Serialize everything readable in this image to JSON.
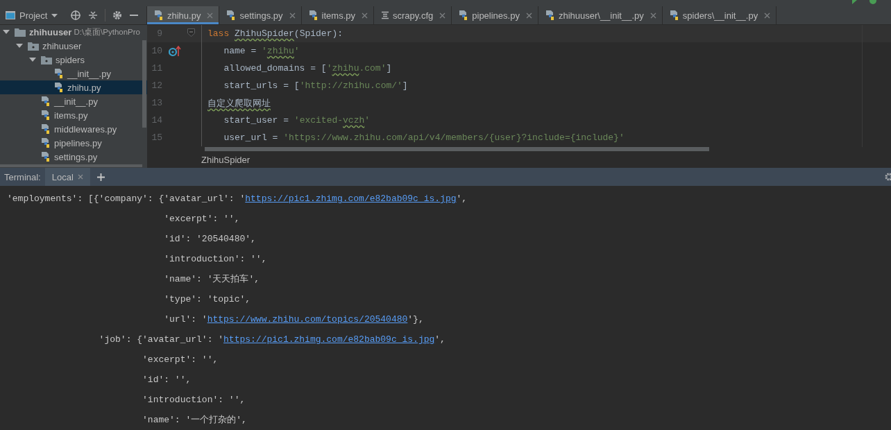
{
  "toolbar": {
    "view_label": "Project"
  },
  "editor_tabs": [
    {
      "label": "zhihu.py",
      "kind": "python",
      "selected": true
    },
    {
      "label": "settings.py",
      "kind": "python",
      "selected": false
    },
    {
      "label": "items.py",
      "kind": "python",
      "selected": false
    },
    {
      "label": "scrapy.cfg",
      "kind": "config",
      "selected": false
    },
    {
      "label": "pipelines.py",
      "kind": "python",
      "selected": false
    },
    {
      "label": "zhihuuser\\__init__.py",
      "kind": "python",
      "selected": false
    },
    {
      "label": "spiders\\__init__.py",
      "kind": "python",
      "selected": false
    }
  ],
  "project_tree": [
    {
      "label": "zhihuuser",
      "path": "D:\\桌面\\PythonPro",
      "kind": "root",
      "expanded": true,
      "selected": false,
      "children": [
        {
          "label": "zhihuuser",
          "kind": "package",
          "expanded": true,
          "selected": false,
          "children": [
            {
              "label": "spiders",
              "kind": "package",
              "expanded": true,
              "selected": false,
              "children": [
                {
                  "label": "__init__.py",
                  "kind": "python",
                  "selected": false
                },
                {
                  "label": "zhihu.py",
                  "kind": "python",
                  "selected": true
                }
              ]
            },
            {
              "label": "__init__.py",
              "kind": "python",
              "selected": false
            },
            {
              "label": "items.py",
              "kind": "python",
              "selected": false
            },
            {
              "label": "middlewares.py",
              "kind": "python",
              "selected": false
            },
            {
              "label": "pipelines.py",
              "kind": "python",
              "selected": false
            },
            {
              "label": "settings.py",
              "kind": "python",
              "selected": false
            }
          ]
        }
      ]
    }
  ],
  "code_lines": [
    {
      "number": "9",
      "kind": "fold",
      "segments": [
        {
          "text": "lass ",
          "kind": "keyword"
        },
        {
          "text": "ZhihuSpider",
          "kind": "plain-typo"
        },
        {
          "text": "(Spider):",
          "kind": "plain"
        }
      ]
    },
    {
      "number": "10",
      "kind": "override",
      "segments": [
        {
          "text": "   name = ",
          "kind": "plain"
        },
        {
          "text": "'",
          "kind": "string"
        },
        {
          "text": "zhihu",
          "kind": "string-typo"
        },
        {
          "text": "'",
          "kind": "string"
        }
      ]
    },
    {
      "number": "11",
      "segments": [
        {
          "text": "   allowed_domains = [",
          "kind": "plain"
        },
        {
          "text": "'",
          "kind": "string"
        },
        {
          "text": "zhihu",
          "kind": "string-typo"
        },
        {
          "text": ".com'",
          "kind": "string"
        },
        {
          "text": "]",
          "kind": "plain"
        }
      ]
    },
    {
      "number": "12",
      "segments": [
        {
          "text": "   start_urls = [",
          "kind": "plain"
        },
        {
          "text": "'http://zhihu.com/'",
          "kind": "string"
        },
        {
          "text": "]",
          "kind": "plain"
        }
      ]
    },
    {
      "number": "13",
      "segments": [
        {
          "text": "自定义爬取网址",
          "kind": "plain-typo"
        }
      ]
    },
    {
      "number": "14",
      "segments": [
        {
          "text": "   start_user = ",
          "kind": "plain"
        },
        {
          "text": "'excited-",
          "kind": "string"
        },
        {
          "text": "vczh",
          "kind": "string-typo"
        },
        {
          "text": "'",
          "kind": "string"
        }
      ]
    },
    {
      "number": "15",
      "segments": [
        {
          "text": "   user_url = ",
          "kind": "plain"
        },
        {
          "text": "'https://www.zhihu.com/api/v4/members/{user}?include={include}'",
          "kind": "string"
        }
      ]
    }
  ],
  "editor_breadcrumb": "ZhihuSpider",
  "terminal": {
    "label": "Terminal:",
    "tabs": [
      {
        "label": "Local",
        "selected": true
      }
    ],
    "lines": [
      [
        {
          "text": "'employments': [{'company': {'avatar_url': '",
          "kind": "text"
        },
        {
          "text": "https://pic1.zhimg.com/e82bab09c_is.jpg",
          "kind": "link"
        },
        {
          "text": "',",
          "kind": "text"
        }
      ],
      [
        {
          "text": "                             'excerpt': '',",
          "kind": "text"
        }
      ],
      [
        {
          "text": "                             'id': '20540480',",
          "kind": "text"
        }
      ],
      [
        {
          "text": "                             'introduction': '',",
          "kind": "text"
        }
      ],
      [
        {
          "text": "                             'name': '天天拍车',",
          "kind": "text"
        }
      ],
      [
        {
          "text": "                             'type': 'topic',",
          "kind": "text"
        }
      ],
      [
        {
          "text": "                             'url': '",
          "kind": "text"
        },
        {
          "text": "https://www.zhihu.com/topics/20540480",
          "kind": "link"
        },
        {
          "text": "'},",
          "kind": "text"
        }
      ],
      [
        {
          "text": "                 'job': {'avatar_url': '",
          "kind": "text"
        },
        {
          "text": "https://pic1.zhimg.com/e82bab09c_is.jpg",
          "kind": "link"
        },
        {
          "text": "',",
          "kind": "text"
        }
      ],
      [
        {
          "text": "                         'excerpt': '',",
          "kind": "text"
        }
      ],
      [
        {
          "text": "                         'id': '',",
          "kind": "text"
        }
      ],
      [
        {
          "text": "                         'introduction': '',",
          "kind": "text"
        }
      ],
      [
        {
          "text": "                         'name': '一个打杂的',",
          "kind": "text"
        }
      ]
    ]
  }
}
